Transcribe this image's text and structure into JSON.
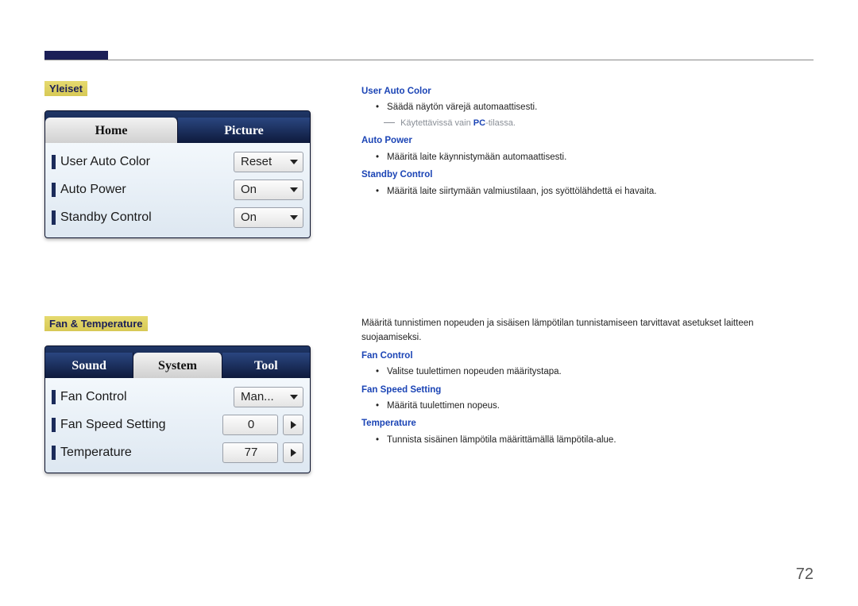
{
  "page_number": "72",
  "section1": {
    "heading": "Yleiset",
    "tabs": [
      "Home",
      "Picture"
    ],
    "active_tab_index": 0,
    "rows": [
      {
        "label": "User Auto Color",
        "value": "Reset",
        "type": "dropdown"
      },
      {
        "label": "Auto Power",
        "value": "On",
        "type": "dropdown"
      },
      {
        "label": "Standby Control",
        "value": "On",
        "type": "dropdown"
      }
    ]
  },
  "section2": {
    "heading": "Fan & Temperature",
    "tabs": [
      "Sound",
      "System",
      "Tool"
    ],
    "active_tab_index": 1,
    "rows": [
      {
        "label": "Fan Control",
        "value": "Man...",
        "type": "dropdown"
      },
      {
        "label": "Fan Speed Setting",
        "value": "0",
        "type": "spinner"
      },
      {
        "label": "Temperature",
        "value": "77",
        "type": "spinner"
      }
    ]
  },
  "desc1": {
    "items": [
      {
        "title": "User Auto Color",
        "bullets": [
          "Säädä näytön värejä automaattisesti."
        ],
        "note_prefix": "Käytettävissä vain ",
        "note_bold": "PC",
        "note_suffix": "-tilassa."
      },
      {
        "title": "Auto Power",
        "bullets": [
          "Määritä laite käynnistymään automaattisesti."
        ]
      },
      {
        "title": "Standby Control",
        "bullets": [
          "Määritä laite siirtymään valmiustilaan, jos syöttölähdettä ei havaita."
        ]
      }
    ]
  },
  "desc2": {
    "intro": "Määritä tunnistimen nopeuden ja sisäisen lämpötilan tunnistamiseen tarvittavat asetukset laitteen suojaamiseksi.",
    "items": [
      {
        "title": "Fan Control",
        "bullets": [
          "Valitse tuulettimen nopeuden määritystapa."
        ]
      },
      {
        "title": "Fan Speed Setting",
        "bullets": [
          "Määritä tuulettimen nopeus."
        ]
      },
      {
        "title": "Temperature",
        "bullets": [
          "Tunnista sisäinen lämpötila määrittämällä lämpötila-alue."
        ]
      }
    ]
  }
}
